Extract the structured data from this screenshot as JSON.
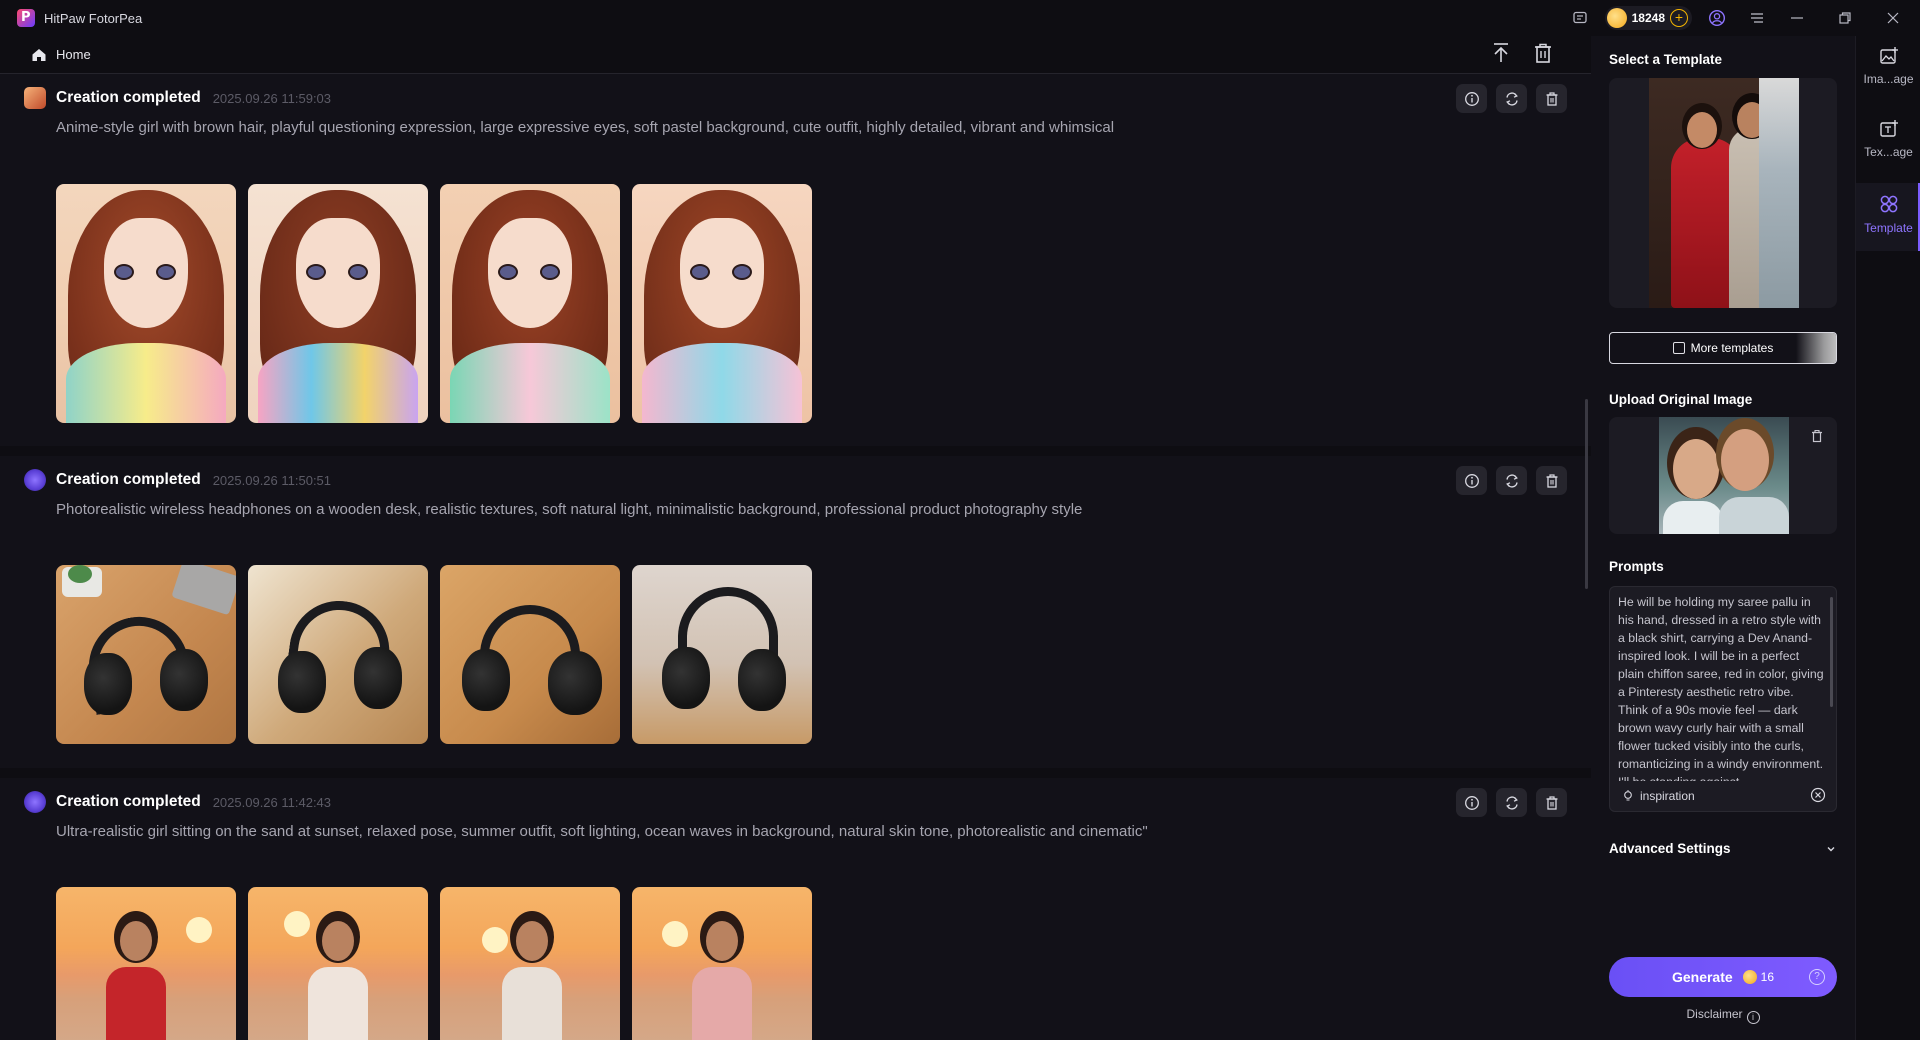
{
  "app": {
    "title": "HitPaw FotorPea",
    "coins": "18248"
  },
  "toolbar": {
    "home_label": "Home"
  },
  "cards": [
    {
      "title": "Creation completed",
      "time": "2025.09.26   11:59:03",
      "prompt": "Anime-style girl with brown hair, playful questioning expression, large expressive eyes, soft pastel background, cute outfit, highly detailed, vibrant and whimsical"
    },
    {
      "title": "Creation completed",
      "time": "2025.09.26   11:50:51",
      "prompt": "Photorealistic wireless headphones on a wooden desk, realistic textures, soft natural light, minimalistic background, professional product photography style"
    },
    {
      "title": "Creation completed",
      "time": "2025.09.26   11:42:43",
      "prompt": "Ultra-realistic girl sitting on the sand at sunset, relaxed pose, summer outfit, soft lighting, ocean waves in background, natural skin tone, photorealistic and cinematic\""
    }
  ],
  "panel": {
    "select_template": "Select a Template",
    "more_templates": "More templates",
    "upload_original": "Upload Original Image",
    "prompts_label": "Prompts",
    "prompt_text": "He will be holding my saree pallu in his hand, dressed in a retro style with a black shirt, carrying a Dev Anand-inspired look. I will be in a perfect plain chiffon saree, red in color, giving a Pinteresty aesthetic retro vibe. Think of a 90s movie feel — dark brown wavy curly hair with a small flower tucked visibly into the curls, romanticizing in a windy environment. I'll be standing against",
    "inspiration": "inspiration",
    "advanced_settings": "Advanced Settings",
    "generate": "Generate",
    "generate_cost": "16",
    "disclaimer": "Disclaimer"
  },
  "rail": [
    {
      "label": "Ima...age",
      "icon": "image-plus-icon"
    },
    {
      "label": "Tex...age",
      "icon": "text-to-image-icon"
    },
    {
      "label": "Template",
      "icon": "template-icon",
      "active": true
    }
  ],
  "colors": {
    "accent": "#7b5cff",
    "coin": "#f4b400",
    "background": "#0e0d12"
  }
}
